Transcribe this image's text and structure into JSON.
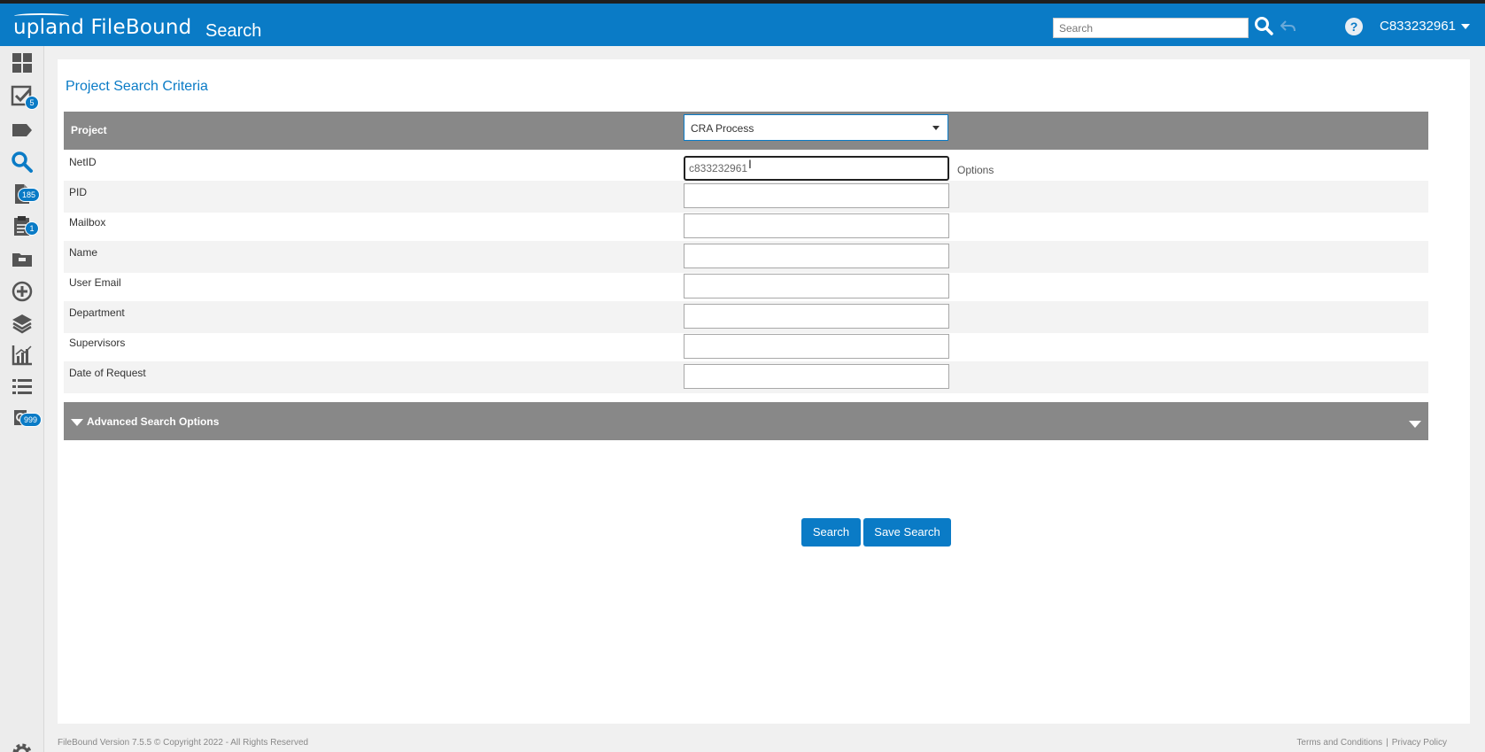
{
  "header": {
    "logo_text": "upland FileBound",
    "page_title": "Search",
    "search_placeholder": "Search",
    "user_name": "C833232961"
  },
  "sidebar": {
    "items": [
      {
        "name": "dashboard-icon",
        "badge": ""
      },
      {
        "name": "tasks-checklist-icon",
        "badge": "5"
      },
      {
        "name": "tag-icon",
        "badge": ""
      },
      {
        "name": "search-icon",
        "badge": ""
      },
      {
        "name": "document-icon",
        "badge": "185"
      },
      {
        "name": "clipboard-icon",
        "badge": "1"
      },
      {
        "name": "folder-icon",
        "badge": ""
      },
      {
        "name": "add-circle-icon",
        "badge": ""
      },
      {
        "name": "layers-icon",
        "badge": ""
      },
      {
        "name": "chart-icon",
        "badge": ""
      },
      {
        "name": "list-icon",
        "badge": ""
      },
      {
        "name": "workflow-icon",
        "badge": "999"
      }
    ],
    "settings_icon": "gear-icon"
  },
  "main": {
    "title": "Project Search Criteria",
    "project": {
      "label": "Project",
      "selected": "CRA Process"
    },
    "fields": [
      {
        "label": "NetID",
        "value": "c833232961"
      },
      {
        "label": "PID",
        "value": ""
      },
      {
        "label": "Mailbox",
        "value": ""
      },
      {
        "label": "Name",
        "value": ""
      },
      {
        "label": "User Email",
        "value": ""
      },
      {
        "label": "Department",
        "value": ""
      },
      {
        "label": "Supervisors",
        "value": ""
      },
      {
        "label": "Date of Request",
        "value": ""
      }
    ],
    "options_link": "Options",
    "advanced_label": "Advanced Search Options",
    "buttons": {
      "search": "Search",
      "save_search": "Save Search"
    }
  },
  "footer": {
    "copyright": "FileBound Version 7.5.5 © Copyright 2022 - All Rights Reserved",
    "terms": "Terms and Conditions",
    "separator": "|",
    "privacy": "Privacy Policy"
  },
  "colors": {
    "brand_blue": "#0a7bc6",
    "header_gray": "#888888"
  }
}
